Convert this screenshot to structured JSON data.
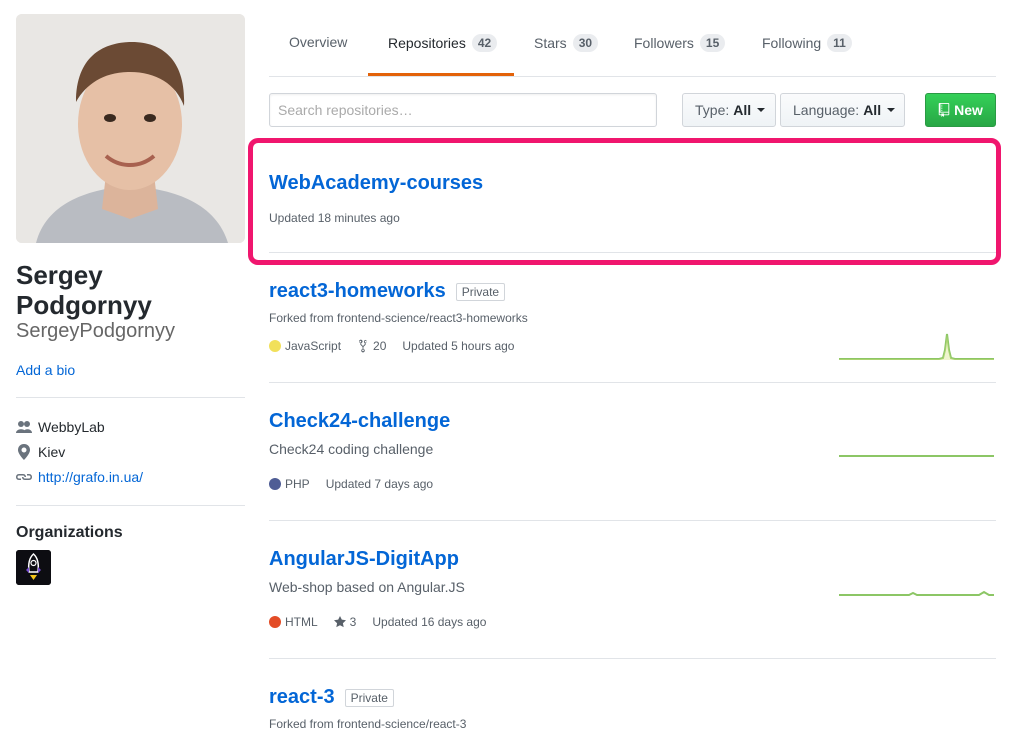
{
  "profile": {
    "name": "Sergey Podgornyy",
    "username": "SergeyPodgornyy",
    "add_bio": "Add a bio",
    "company": "WebbyLab",
    "location": "Kiev",
    "website": "http://grafo.in.ua/",
    "organizations_title": "Organizations"
  },
  "tabs": [
    {
      "label": "Overview",
      "count": null
    },
    {
      "label": "Repositories",
      "count": "42"
    },
    {
      "label": "Stars",
      "count": "30"
    },
    {
      "label": "Followers",
      "count": "15"
    },
    {
      "label": "Following",
      "count": "11"
    }
  ],
  "filters": {
    "search_placeholder": "Search repositories…",
    "type_label": "Type:",
    "type_value": "All",
    "language_label": "Language:",
    "language_value": "All",
    "new_label": "New"
  },
  "repos": [
    {
      "name": "WebAcademy-courses",
      "updated": "Updated 18 minutes ago"
    },
    {
      "name": "react3-homeworks",
      "private": "Private",
      "forked": "Forked from frontend-science/react3-homeworks",
      "language": "JavaScript",
      "lang_color": "#f1e05a",
      "forks": "20",
      "updated": "Updated 5 hours ago"
    },
    {
      "name": "Check24-challenge",
      "description": "Check24 coding challenge",
      "language": "PHP",
      "lang_color": "#4F5D95",
      "updated": "Updated 7 days ago"
    },
    {
      "name": "AngularJS-DigitApp",
      "description": "Web-shop based on Angular.JS",
      "language": "HTML",
      "lang_color": "#e34c26",
      "stars": "3",
      "updated": "Updated 16 days ago"
    },
    {
      "name": "react-3",
      "private": "Private",
      "forked": "Forked from frontend-science/react-3"
    }
  ]
}
